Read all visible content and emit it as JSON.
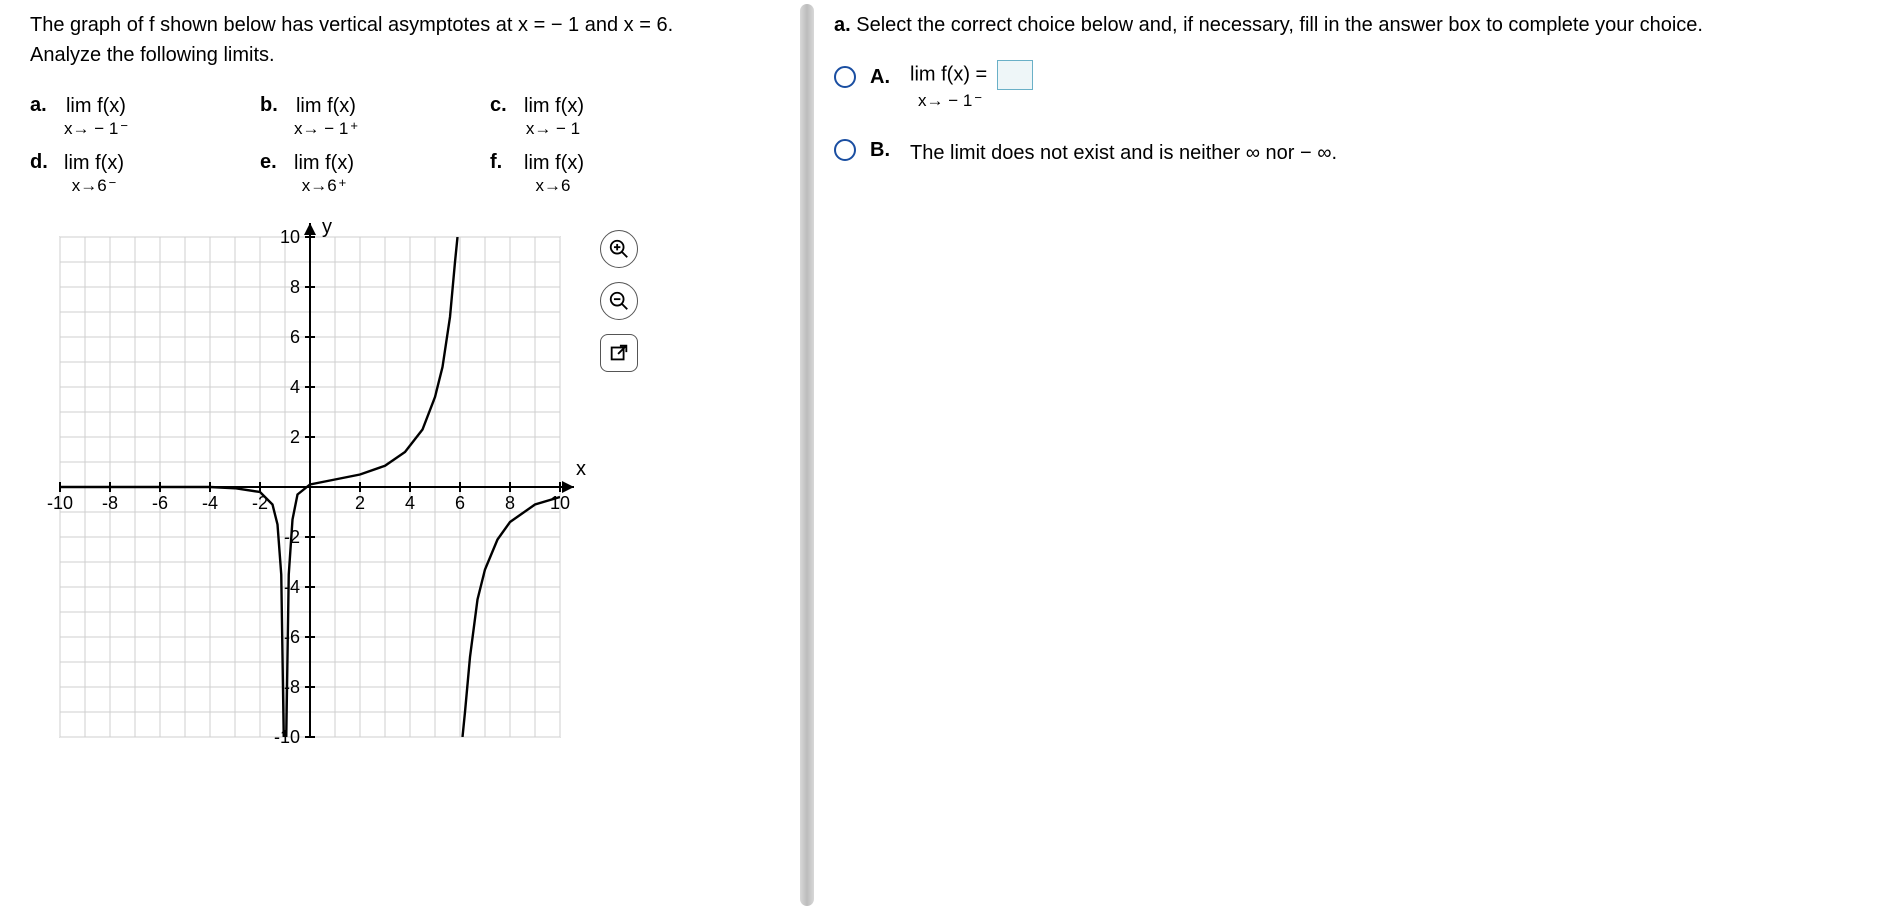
{
  "problem": {
    "intro_line1": "The graph of f shown below has vertical asymptotes at x = − 1 and x = 6.",
    "intro_line2": "Analyze the following limits."
  },
  "limits": {
    "a": {
      "label": "a.",
      "top": "lim   f(x)",
      "bot": "x→ − 1",
      "sup": "−"
    },
    "b": {
      "label": "b.",
      "top": "lim   f(x)",
      "bot": "x→ − 1",
      "sup": "+"
    },
    "c": {
      "label": "c.",
      "top": "lim  f(x)",
      "bot": "x→ − 1",
      "sup": ""
    },
    "d": {
      "label": "d.",
      "top": "lim  f(x)",
      "bot": "x→6",
      "sup": "−"
    },
    "e": {
      "label": "e.",
      "top": "lim  f(x)",
      "bot": "x→6",
      "sup": "+"
    },
    "f": {
      "label": "f.",
      "top": "lim f(x)",
      "bot": "x→6",
      "sup": ""
    }
  },
  "chart_data": {
    "type": "line",
    "title": "",
    "xlabel": "x",
    "ylabel": "y",
    "xlim": [
      -10,
      10
    ],
    "ylim": [
      -10,
      10
    ],
    "x_ticks": [
      -10,
      -8,
      -6,
      -4,
      -2,
      2,
      4,
      6,
      8,
      10
    ],
    "y_ticks": [
      -10,
      -8,
      -6,
      -4,
      -2,
      2,
      4,
      6,
      8,
      10
    ],
    "vertical_asymptotes": [
      -1,
      6
    ],
    "series": [
      {
        "name": "branch x<-1",
        "x": [
          -10,
          -8,
          -6,
          -4,
          -3,
          -2,
          -1.5,
          -1.3,
          -1.15,
          -1.05
        ],
        "y": [
          0,
          0,
          0,
          0,
          -0.05,
          -0.2,
          -0.7,
          -1.5,
          -3.5,
          -10
        ]
      },
      {
        "name": "branch -1<x<6",
        "x": [
          -0.95,
          -0.85,
          -0.7,
          -0.5,
          0,
          1,
          2,
          3,
          3.8,
          4.5,
          5,
          5.3,
          5.6,
          5.8,
          5.9
        ],
        "y": [
          -10,
          -3.5,
          -1.3,
          -0.3,
          0.1,
          0.3,
          0.5,
          0.85,
          1.4,
          2.3,
          3.6,
          4.8,
          6.8,
          9,
          10
        ]
      },
      {
        "name": "branch x>6",
        "x": [
          6.1,
          6.2,
          6.4,
          6.7,
          7,
          7.5,
          8,
          9,
          10
        ],
        "y": [
          -10,
          -9,
          -6.8,
          -4.5,
          -3.3,
          -2.1,
          -1.4,
          -0.7,
          -0.4
        ]
      }
    ]
  },
  "answer_part": {
    "prompt_lead": "a.",
    "prompt": "Select the correct choice below and, if necessary, fill in the answer box to complete your choice.",
    "A_label": "A.",
    "A_limtop": "lim   f(x) =",
    "A_limbot": "x→ − 1",
    "A_sup": "−",
    "B_label": "B.",
    "B_text": "The limit does not exist and is neither ∞ nor − ∞."
  }
}
